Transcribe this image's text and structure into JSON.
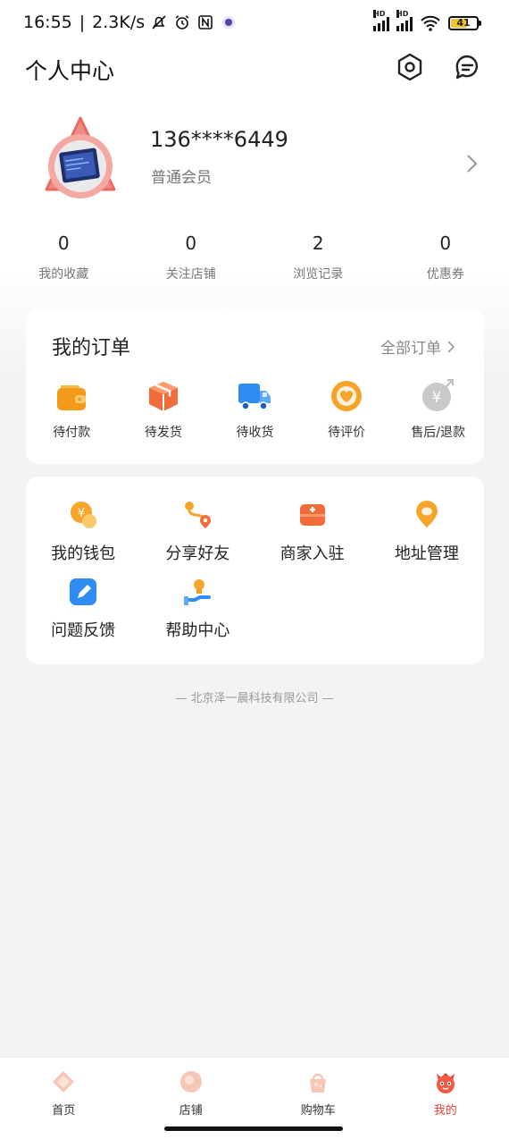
{
  "status_bar": {
    "time": "16:55",
    "network_speed": "2.3K/s",
    "signal_label_1": "HD",
    "signal_label_2": "HD",
    "battery_level": "41"
  },
  "header": {
    "title": "个人中心"
  },
  "profile": {
    "phone": "136****6449",
    "member_level": "普通会员"
  },
  "stats": [
    {
      "value": "0",
      "label": "我的收藏"
    },
    {
      "value": "0",
      "label": "关注店铺"
    },
    {
      "value": "2",
      "label": "浏览记录"
    },
    {
      "value": "0",
      "label": "优惠券"
    }
  ],
  "orders": {
    "title": "我的订单",
    "all_label": "全部订单",
    "items": [
      {
        "label": "待付款",
        "icon": "wallet-icon"
      },
      {
        "label": "待发货",
        "icon": "package-icon"
      },
      {
        "label": "待收货",
        "icon": "truck-icon"
      },
      {
        "label": "待评价",
        "icon": "heart-icon"
      },
      {
        "label": "售后/退款",
        "icon": "refund-icon"
      }
    ]
  },
  "services": {
    "items": [
      {
        "label": "我的钱包",
        "icon": "wallet-coin-icon"
      },
      {
        "label": "分享好友",
        "icon": "share-route-icon"
      },
      {
        "label": "商家入驻",
        "icon": "merchant-box-icon"
      },
      {
        "label": "地址管理",
        "icon": "location-pin-icon"
      },
      {
        "label": "问题反馈",
        "icon": "feedback-pen-icon"
      },
      {
        "label": "帮助中心",
        "icon": "help-bulb-icon"
      }
    ]
  },
  "footer_note": "— 北京泽一晨科技有限公司 —",
  "tab_bar": {
    "active_color": "#e8413a",
    "tabs": [
      {
        "label": "首页",
        "icon": "home-icon"
      },
      {
        "label": "店铺",
        "icon": "store-icon"
      },
      {
        "label": "购物车",
        "icon": "cart-bag-icon"
      },
      {
        "label": "我的",
        "icon": "profile-mascot-icon",
        "active": true
      }
    ]
  }
}
